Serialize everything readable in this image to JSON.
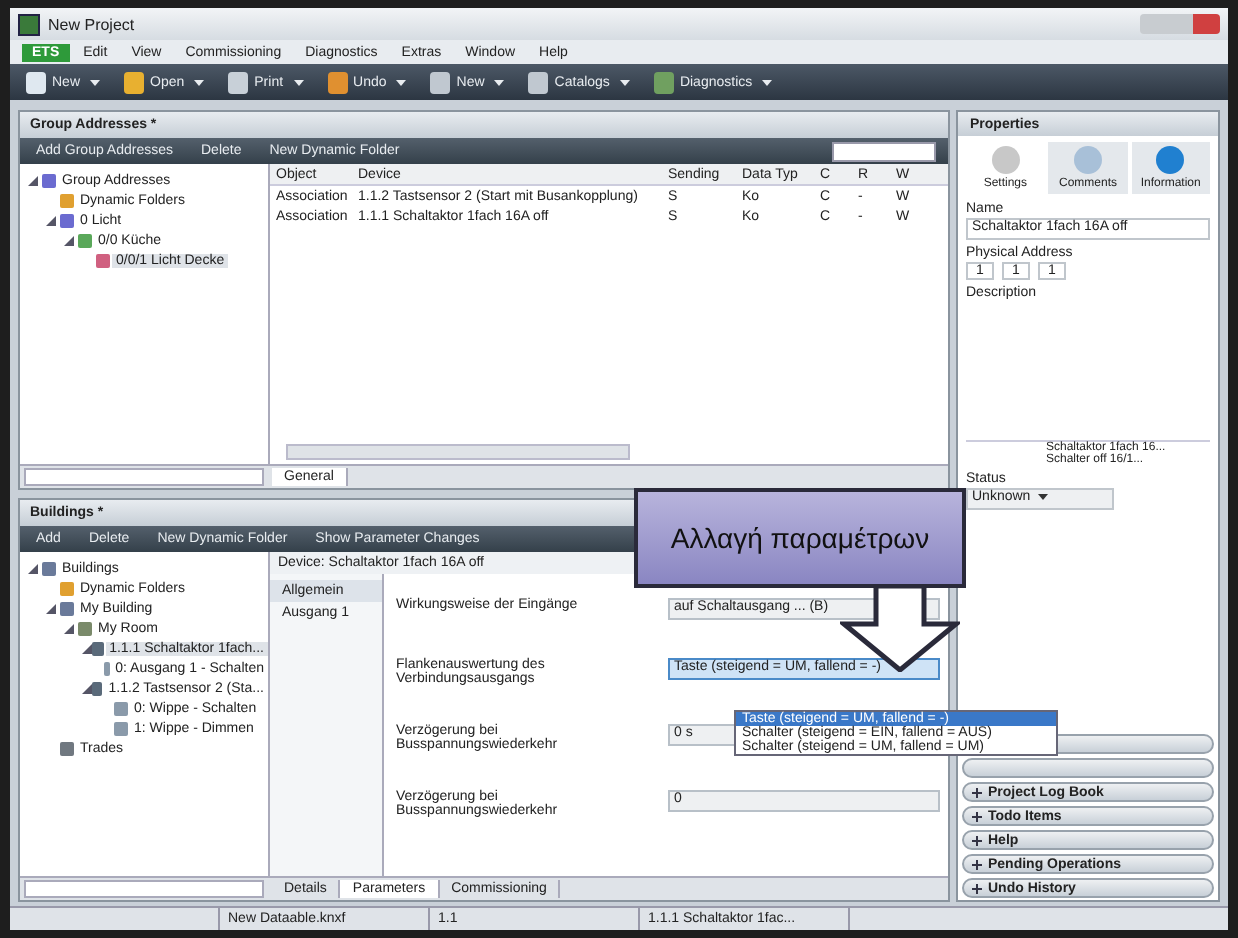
{
  "window": {
    "title": "New Project"
  },
  "menu": [
    {
      "label": "ETS",
      "selected": true
    },
    {
      "label": "Edit",
      "selected": false
    },
    {
      "label": "View",
      "selected": false
    },
    {
      "label": "Commissioning",
      "selected": false
    },
    {
      "label": "Diagnostics",
      "selected": false
    },
    {
      "label": "Extras",
      "selected": false
    },
    {
      "label": "Window",
      "selected": false
    },
    {
      "label": "Help",
      "selected": false
    }
  ],
  "toolbar": [
    {
      "label": "New",
      "kind": "doc"
    },
    {
      "label": "Open",
      "kind": "folder"
    },
    {
      "label": "Print",
      "kind": "print"
    },
    {
      "label": "Undo",
      "kind": "undo"
    },
    {
      "label": "New",
      "kind": "view"
    },
    {
      "label": "Catalogs",
      "kind": "view"
    },
    {
      "label": "Diagnostics",
      "kind": "diag"
    }
  ],
  "group_addresses": {
    "title": "Group Addresses *",
    "toolbar": [
      "Add Group Addresses",
      "Delete",
      "New Dynamic Folder"
    ],
    "tree": [
      {
        "label": "Group Addresses",
        "kind": "ga",
        "selected": false,
        "children": [
          {
            "label": "Dynamic Folders",
            "kind": "folder",
            "selected": false
          },
          {
            "label": "0 Licht",
            "kind": "ga",
            "selected": false,
            "children": [
              {
                "label": "0/0 Küche",
                "kind": "middle",
                "selected": false,
                "children": [
                  {
                    "label": "0/0/1 Licht Decke",
                    "kind": "address",
                    "selected": true
                  }
                ]
              }
            ]
          }
        ]
      }
    ],
    "columns": [
      "Object",
      "Device",
      "Sending",
      "Data Typ",
      "C",
      "R",
      "W"
    ],
    "rows": [
      [
        "Association",
        "1.1.2 Tastsensor 2 (Start mit Busankopplung)",
        "S",
        "Ko",
        "C",
        "-",
        "W"
      ],
      [
        "Association",
        "1.1.1 Schaltaktor 1fach 16A off",
        "S",
        "Ko",
        "C",
        "-",
        "W"
      ]
    ],
    "tabs": [
      {
        "label": "General",
        "selected": true
      }
    ]
  },
  "buildings": {
    "title": "Buildings *",
    "toolbar": [
      "Add",
      "Delete",
      "New Dynamic Folder",
      "Show Parameter Changes"
    ],
    "tree": [
      {
        "label": "Buildings",
        "kind": "building",
        "selected": false,
        "children": [
          {
            "label": "Dynamic Folders",
            "kind": "folder",
            "selected": false
          },
          {
            "label": "My Building",
            "kind": "building",
            "selected": false,
            "children": [
              {
                "label": "My Room",
                "kind": "room",
                "selected": false,
                "children": [
                  {
                    "label": "1.1.1 Schaltaktor 1fach...",
                    "kind": "device",
                    "selected": true,
                    "children": [
                      {
                        "label": "0: Ausgang 1 - Schalten",
                        "kind": "object",
                        "selected": false
                      }
                    ]
                  },
                  {
                    "label": "1.1.2 Tastsensor 2 (Sta...",
                    "kind": "device",
                    "selected": false,
                    "children": [
                      {
                        "label": "0: Wippe - Schalten",
                        "kind": "object",
                        "selected": false
                      },
                      {
                        "label": "1: Wippe - Dimmen",
                        "kind": "object",
                        "selected": false
                      }
                    ]
                  }
                ]
              }
            ]
          },
          {
            "label": "Trades",
            "kind": "trades",
            "selected": false
          }
        ]
      }
    ],
    "device_title": "Device: Schaltaktor 1fach 16A off",
    "param_pages": [
      {
        "label": "Allgemein",
        "selected": true
      },
      {
        "label": "Ausgang 1",
        "selected": false
      }
    ],
    "params": [
      {
        "label": "Wirkungsweise der Eingänge",
        "value": "auf Schaltausgang ... (B)",
        "open": false
      },
      {
        "label": "Flankenauswertung des Verbindungsausgangs",
        "value": "Taste (steigend = UM, fallend = -)",
        "open": true
      },
      {
        "label": "Verzögerung bei Busspannungswiederkehr",
        "value": "0 s",
        "open": false
      },
      {
        "label": "Verzögerung bei Busspannungswiederkehr",
        "value": "0",
        "open": false
      }
    ],
    "dropdown": [
      {
        "label": "Taste (steigend = UM, fallend = -)",
        "selected": true
      },
      {
        "label": "Schalter (steigend = EIN, fallend = AUS)",
        "selected": false
      },
      {
        "label": "Schalter (steigend = UM, fallend = UM)",
        "selected": false
      }
    ],
    "tabs": [
      {
        "label": "Details",
        "selected": false
      },
      {
        "label": "Parameters",
        "selected": true
      },
      {
        "label": "Commissioning",
        "selected": false
      }
    ]
  },
  "properties": {
    "title": "Properties",
    "tabs": [
      {
        "label": "Settings",
        "kind": "settings",
        "selected": true
      },
      {
        "label": "Comments",
        "kind": "comments",
        "selected": false
      },
      {
        "label": "Information",
        "kind": "info",
        "selected": false
      }
    ],
    "name_label": "Name",
    "name": "Schaltaktor 1fach 16A off",
    "address_label": "Physical Address",
    "address": [
      "1",
      "1",
      "1"
    ],
    "description_label": "Description",
    "info": [
      "Schaltaktor 1fach 16...",
      "Schalter off 16/1..."
    ],
    "status_label": "Status",
    "status": "Unknown"
  },
  "sections": [
    "Project Log Book",
    "Todo Items",
    "Help",
    "Pending Operations",
    "Undo History"
  ],
  "status_bar": [
    "New Dataable.knxf",
    "1.1",
    "1.1.1 Schaltaktor 1fac..."
  ],
  "callout": "Αλλαγή παραμέτρων"
}
